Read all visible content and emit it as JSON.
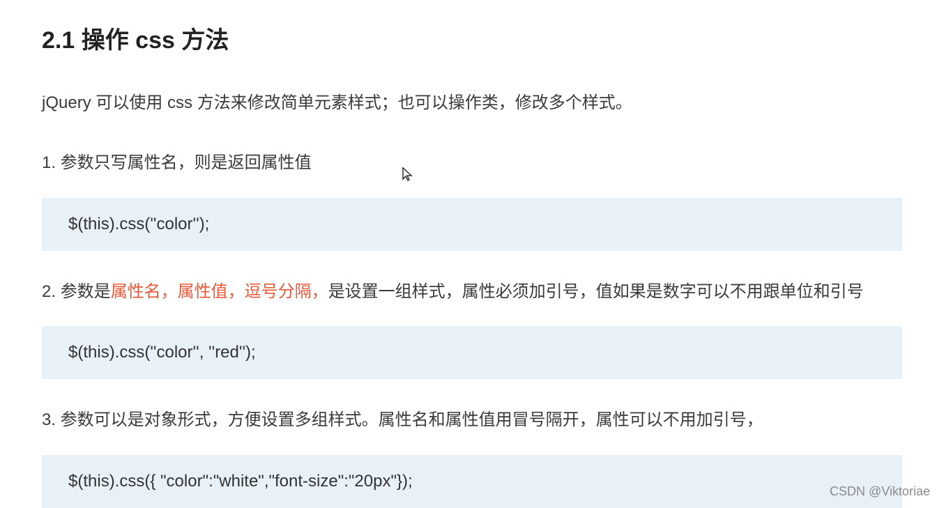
{
  "heading": "2.1  操作 css 方法",
  "intro": "jQuery 可以使用 css 方法来修改简单元素样式；也可以操作类，修改多个样式。",
  "item1": {
    "text": "1. 参数只写属性名，则是返回属性值",
    "code": "$(this).css(''color'');"
  },
  "item2": {
    "prefix": "2.  参数是",
    "highlight": "属性名，属性值，逗号分隔，",
    "suffix": "是设置一组样式，属性必须加引号，值如果是数字可以不用跟单位和引号",
    "code": "$(this).css(''color'', ''red'');"
  },
  "item3": {
    "text": "3.  参数可以是对象形式，方便设置多组样式。属性名和属性值用冒号隔开，属性可以不用加引号，",
    "code": "$(this).css({ \"color\":\"white\",\"font-size\":\"20px\"});"
  },
  "watermark": "CSDN @Viktoriae"
}
